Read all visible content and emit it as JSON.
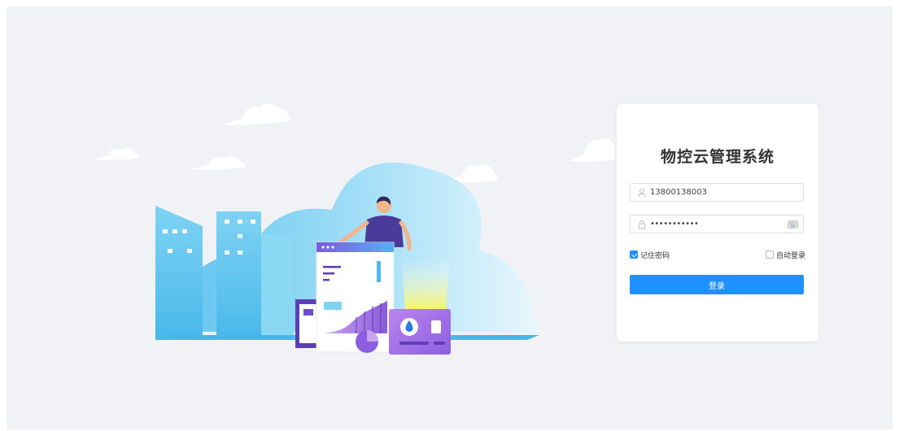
{
  "login": {
    "title": "物控云管理系统",
    "username_value": "13800138003",
    "password_value": "•••••••••••",
    "remember_label": "记住密码",
    "remember_checked": true,
    "auto_login_label": "自动登录",
    "auto_login_checked": false,
    "submit_label": "登录"
  },
  "icons": {
    "user": "user-icon",
    "lock": "lock-icon",
    "keyboard": "keyboard-icon"
  },
  "colors": {
    "primary": "#1e90ff",
    "background": "#f0f2f5",
    "card": "#ffffff"
  }
}
